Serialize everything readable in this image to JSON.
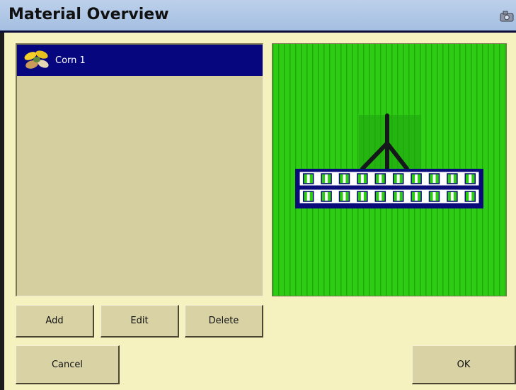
{
  "window": {
    "title": "Material Overview",
    "camera_icon": "camera-icon"
  },
  "materials": {
    "items": [
      {
        "label": "Corn 1",
        "icon": "seed-icon",
        "selected": true
      }
    ]
  },
  "preview": {
    "icon": "implement-preview",
    "field_color": "#2ccd12",
    "rows_per_bar": 10
  },
  "buttons": {
    "add": "Add",
    "edit": "Edit",
    "delete": "Delete",
    "cancel": "Cancel",
    "ok": "OK"
  },
  "colors": {
    "selection": "#06067e",
    "background": "#f6f2bf",
    "title_bar": "#b2c8e6"
  }
}
